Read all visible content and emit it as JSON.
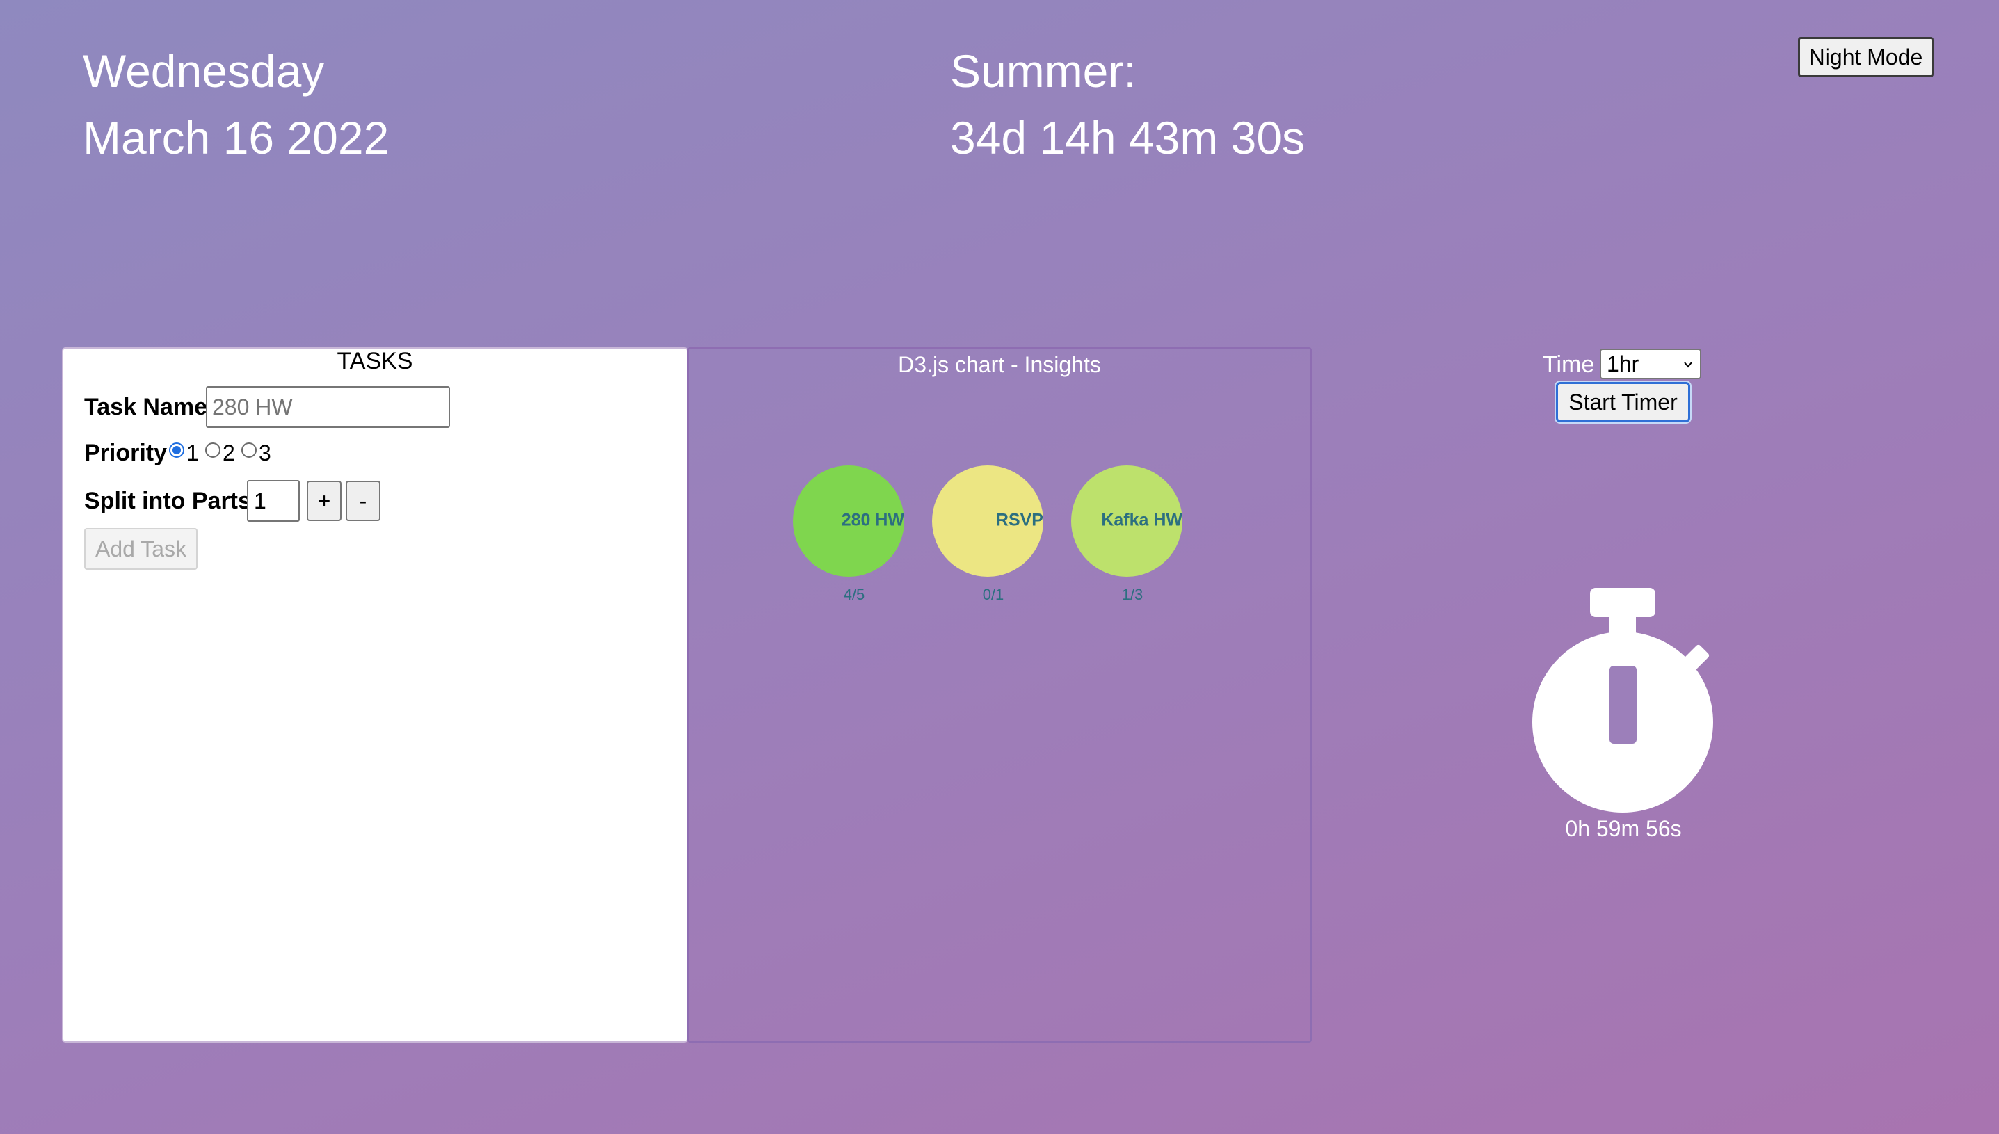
{
  "header": {
    "day": "Wednesday",
    "date": "March 16 2022",
    "summer_label": "Summer:",
    "summer_countdown": "34d 14h 43m 30s",
    "night_mode_label": "Night Mode"
  },
  "tasks": {
    "title": "TASKS",
    "task_name_label": "Task Name",
    "task_name_placeholder": "280 HW",
    "priority_label": "Priority",
    "priority_options": [
      "1",
      "2",
      "3"
    ],
    "priority_selected": "1",
    "split_label": "Split into Parts",
    "split_value": "1",
    "plus_label": "+",
    "minus_label": "-",
    "add_task_label": "Add Task"
  },
  "chart": {
    "title": "D3.js chart - Insights"
  },
  "chart_data": {
    "type": "scatter",
    "title": "D3.js chart - Insights",
    "items": [
      {
        "name": "280 HW",
        "label": "4/5",
        "done": 4,
        "total": 5,
        "color": "#7fd64e"
      },
      {
        "name": "RSVP",
        "label": "0/1",
        "done": 0,
        "total": 1,
        "color": "#ece683"
      },
      {
        "name": "Kafka HW",
        "label": "1/3",
        "done": 1,
        "total": 3,
        "color": "#bde16c"
      }
    ],
    "label_color": "#2c6f80"
  },
  "timer": {
    "time_label": "Time",
    "time_selected": "1hr",
    "start_label": "Start Timer",
    "readout": "0h 59m 56s",
    "icon": "stopwatch-icon"
  }
}
